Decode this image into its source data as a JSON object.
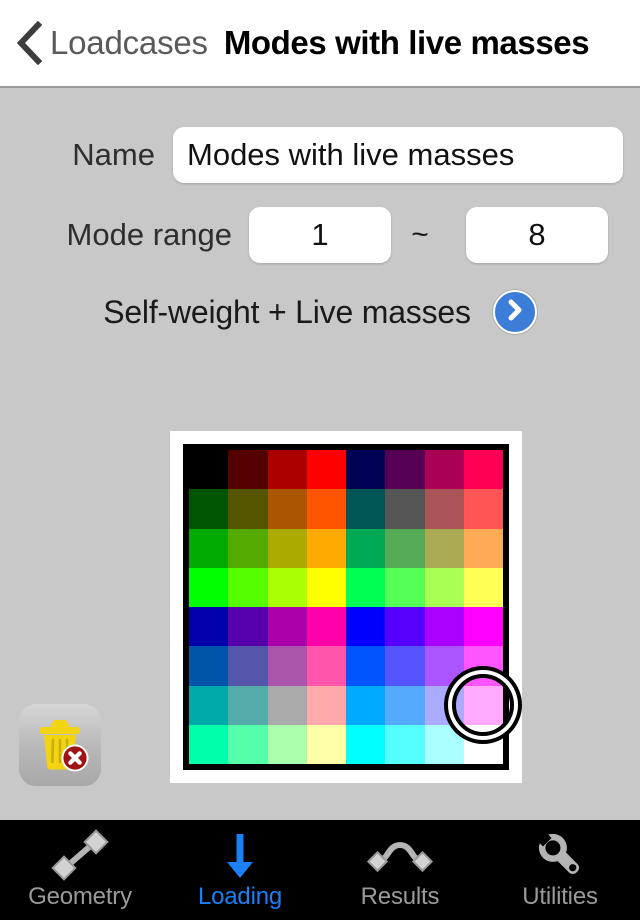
{
  "header": {
    "back_icon": "chevron-left-icon",
    "back_label": "Loadcases",
    "title": "Modes with live masses"
  },
  "form": {
    "name_label": "Name",
    "name_value": "Modes with live masses",
    "name_placeholder": "Name",
    "mode_range_label": "Mode range",
    "mode_from_value": "1",
    "mode_from_placeholder": "1",
    "mode_separator": "~",
    "mode_to_value": "8",
    "mode_to_placeholder": "8",
    "load_combination_label": "Self-weight + Live masses",
    "disclosure_icon": "chevron-right-circle-icon",
    "accent_color": "#3b7dd8"
  },
  "palette": {
    "selected_index": 55,
    "selected_color": "#ff99ff",
    "rows": [
      [
        "#000000",
        "#550000",
        "#aa0000",
        "#ff0000",
        "#000055",
        "#550055",
        "#aa0055",
        "#ff0055"
      ],
      [
        "#005500",
        "#555500",
        "#aa5500",
        "#ff5500",
        "#005555",
        "#555555",
        "#aa5555",
        "#ff5555"
      ],
      [
        "#00aa00",
        "#55aa00",
        "#aaaa00",
        "#ffaa00",
        "#00aa55",
        "#55aa55",
        "#aaaa55",
        "#ffaa55"
      ],
      [
        "#00ff00",
        "#55ff00",
        "#aaff00",
        "#ffff00",
        "#00ff55",
        "#55ff55",
        "#aaff55",
        "#ffff55"
      ],
      [
        "#0000aa",
        "#5500aa",
        "#aa00aa",
        "#ff00aa",
        "#0000ff",
        "#5500ff",
        "#aa00ff",
        "#ff00ff"
      ],
      [
        "#0055aa",
        "#5555aa",
        "#aa55aa",
        "#ff55aa",
        "#0055ff",
        "#5555ff",
        "#aa55ff",
        "#ff55ff"
      ],
      [
        "#00aaaa",
        "#55aaaa",
        "#aaaaaa",
        "#ffaaaa",
        "#00aaff",
        "#55aaff",
        "#aaaaff",
        "#ffaaff"
      ],
      [
        "#00ffaa",
        "#55ffaa",
        "#aaffaa",
        "#ffffaa",
        "#00ffff",
        "#55ffff",
        "#aaffff",
        "#ffffff"
      ]
    ]
  },
  "delete": {
    "icon": "trash-delete-icon",
    "badge_icon": "x-circle-icon",
    "trash_color": "#f2d413",
    "badge_color": "#9e1414"
  },
  "tabbar": {
    "active_color": "#1b7ff5",
    "inactive_color": "#9a9a9a",
    "tabs": [
      {
        "label": "Geometry",
        "icon": "member-bar-icon",
        "active": false
      },
      {
        "label": "Loading",
        "icon": "down-arrow-icon",
        "active": true
      },
      {
        "label": "Results",
        "icon": "deflected-beam-icon",
        "active": false
      },
      {
        "label": "Utilities",
        "icon": "wrench-icon",
        "active": false
      }
    ]
  }
}
